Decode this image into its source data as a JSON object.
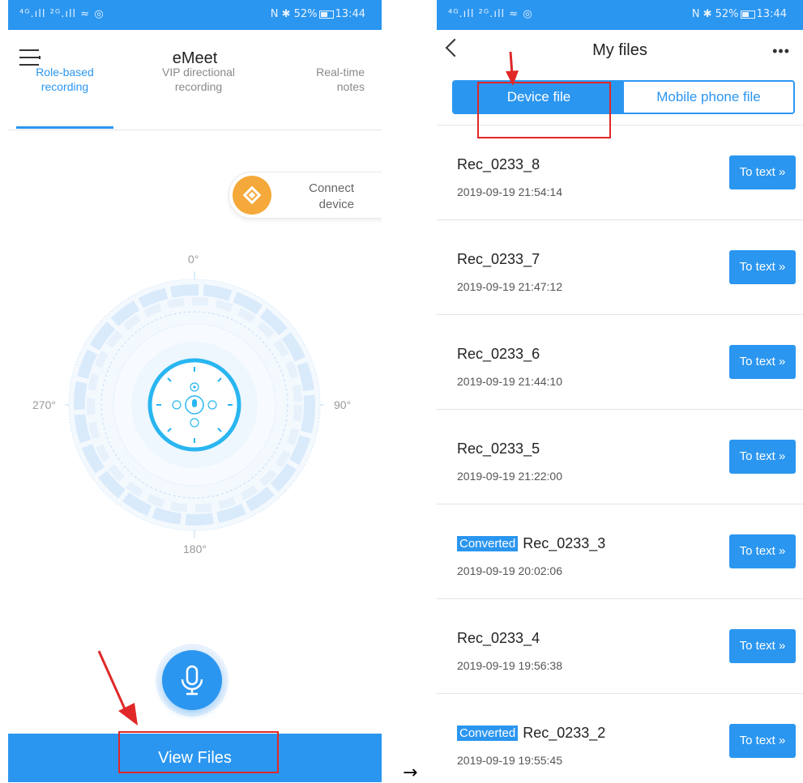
{
  "status": {
    "left": "⁴ᴳ.ıll ²ᴳ.ıll ≈ ◎",
    "right": "N ✱ 52%",
    "time": "13:44"
  },
  "left_screen": {
    "title": "eMeet",
    "tabs": [
      {
        "line1": "Role-based",
        "line2": "recording",
        "active": true
      },
      {
        "line1": "VIP directional",
        "line2": "recording",
        "active": false
      },
      {
        "line1": "Real-time",
        "line2": "notes",
        "active": false
      }
    ],
    "connect_line1": "Connect",
    "connect_line2": "device",
    "degrees": {
      "top": "0°",
      "right": "90°",
      "bottom": "180°",
      "left": "270°"
    },
    "view_files_label": "View Files"
  },
  "separator_arrow": "→",
  "right_screen": {
    "title": "My files",
    "more": "•••",
    "segments": [
      "Device file",
      "Mobile phone file"
    ],
    "to_text_label": "To text »",
    "badge_label": "Converted",
    "files": [
      {
        "name": "Rec_0233_8",
        "date": "2019-09-19 21:54:14",
        "converted": false
      },
      {
        "name": "Rec_0233_7",
        "date": "2019-09-19 21:47:12",
        "converted": false
      },
      {
        "name": "Rec_0233_6",
        "date": "2019-09-19 21:44:10",
        "converted": false
      },
      {
        "name": "Rec_0233_5",
        "date": "2019-09-19 21:22:00",
        "converted": false
      },
      {
        "name": "Rec_0233_3",
        "date": "2019-09-19 20:02:06",
        "converted": true
      },
      {
        "name": "Rec_0233_4",
        "date": "2019-09-19 19:56:38",
        "converted": false
      },
      {
        "name": "Rec_0233_2",
        "date": "2019-09-19 19:55:45",
        "converted": true
      }
    ]
  },
  "colors": {
    "accent": "#2b96f0",
    "annotation_red": "#e02828",
    "connect_orange": "#f4a93a"
  }
}
